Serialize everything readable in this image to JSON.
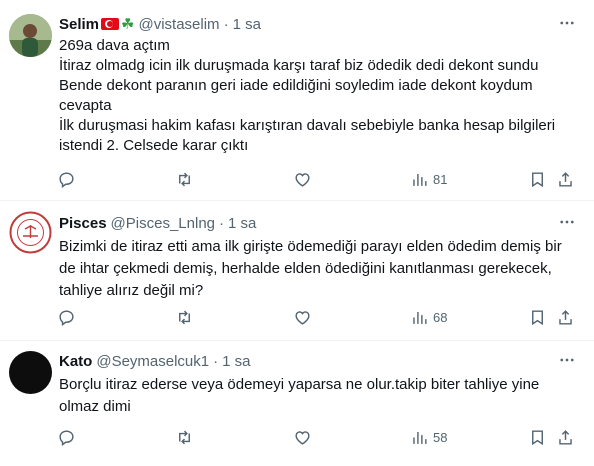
{
  "tweets": [
    {
      "name": "Selim",
      "emoji_flag": "turkey-flag-icon",
      "emoji_clover": "☘",
      "handle": "@vistaselim",
      "separator": "·",
      "time": "1 sa",
      "lines": [
        "269a dava açtım",
        "İtiraz olmadg icin ilk  duruşmada karşı taraf biz ödedik dedi dekont sundu",
        "Bende dekont paranın geri iade edildiğini soyledim iade dekont koydum",
        "cevapta",
        "İlk  duruşmasi hakim kafası karıştıran davalı sebebiyle banka hesap bilgileri",
        "istendi 2. Celsede karar çıktı"
      ],
      "views": "81"
    },
    {
      "name": "Pisces",
      "handle": "@Pisces_Lnlng",
      "separator": "·",
      "time": "1 sa",
      "lines": [
        "Bizimki de itiraz etti ama ilk girişte ödemediği parayı elden ödedim demiş bir",
        "de ihtar çekmedi demiş, herhalde elden ödediğini kanıtlanması gerekecek,",
        "tahliye alırız değil mi?"
      ],
      "views": "68"
    },
    {
      "name": "Kato",
      "handle": "@Seymaselcuk1",
      "separator": "·",
      "time": "1 sa",
      "lines": [
        "Borçlu itiraz ederse veya ödemeyi yaparsa ne olur.takip biter tahliye yine",
        "olmaz dimi"
      ],
      "views": "58"
    }
  ],
  "icons": {
    "reply": "reply-icon",
    "retweet": "retweet-icon",
    "like": "like-icon",
    "views": "views-icon",
    "bookmark": "bookmark-icon",
    "share": "share-icon",
    "more": "more-icon"
  },
  "colors": {
    "text": "#0f1419",
    "secondary": "#536471",
    "divider": "#eff3f4",
    "flag_red": "#e30a17"
  }
}
